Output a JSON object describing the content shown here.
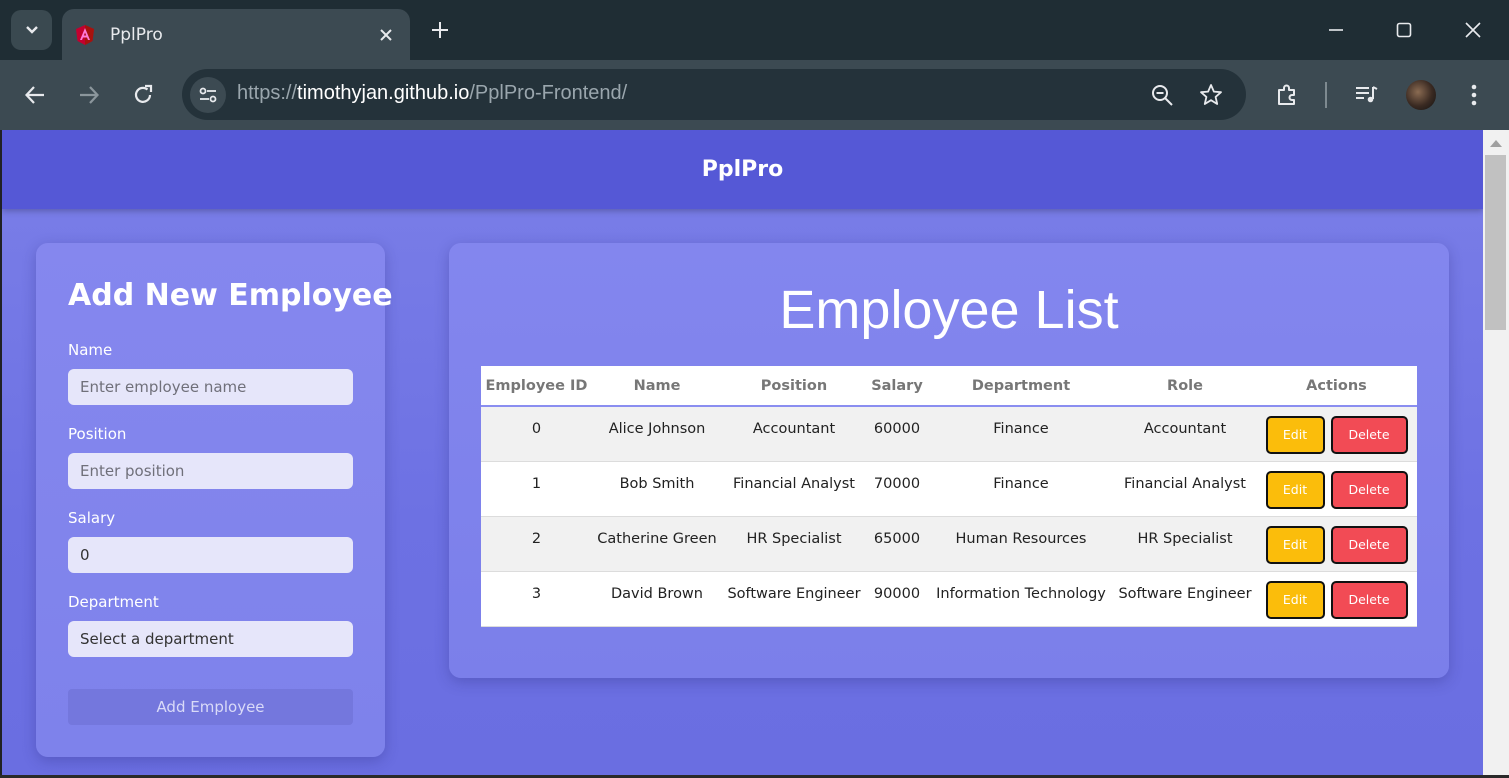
{
  "browser": {
    "tab": {
      "title": "PplPro"
    },
    "url": {
      "scheme": "https://",
      "host": "timothyjan.github.io",
      "path": "/PplPro-Frontend/"
    }
  },
  "app": {
    "title": "PplPro"
  },
  "form": {
    "heading": "Add New Employee",
    "name_label": "Name",
    "name_placeholder": "Enter employee name",
    "position_label": "Position",
    "position_placeholder": "Enter position",
    "salary_label": "Salary",
    "salary_value": "0",
    "department_label": "Department",
    "department_selected": "Select a department",
    "submit_label": "Add Employee"
  },
  "list": {
    "title": "Employee List",
    "columns": [
      "Employee ID",
      "Name",
      "Position",
      "Salary",
      "Department",
      "Role",
      "Actions"
    ],
    "rows": [
      {
        "id": "0",
        "name": "Alice Johnson",
        "position": "Accountant",
        "salary": "60000",
        "department": "Finance",
        "role": "Accountant"
      },
      {
        "id": "1",
        "name": "Bob Smith",
        "position": "Financial Analyst",
        "salary": "70000",
        "department": "Finance",
        "role": "Financial Analyst"
      },
      {
        "id": "2",
        "name": "Catherine Green",
        "position": "HR Specialist",
        "salary": "65000",
        "department": "Human Resources",
        "role": "HR Specialist"
      },
      {
        "id": "3",
        "name": "David Brown",
        "position": "Software Engineer",
        "salary": "90000",
        "department": "Information Technology",
        "role": "Software Engineer"
      }
    ],
    "edit_label": "Edit",
    "delete_label": "Delete"
  },
  "colors": {
    "header": "#5558d6",
    "background": "#7b7fe8",
    "edit_button": "#fbbd0b",
    "delete_button": "#f24b55"
  },
  "icons": [
    "tab-search-icon",
    "angular-favicon-icon",
    "close-icon",
    "plus-icon",
    "minimize-icon",
    "maximize-icon",
    "window-close-icon",
    "back-icon",
    "forward-icon",
    "reload-icon",
    "site-info-icon",
    "zoom-icon",
    "bookmark-star-icon",
    "extensions-icon",
    "media-icon",
    "menu-icon"
  ]
}
